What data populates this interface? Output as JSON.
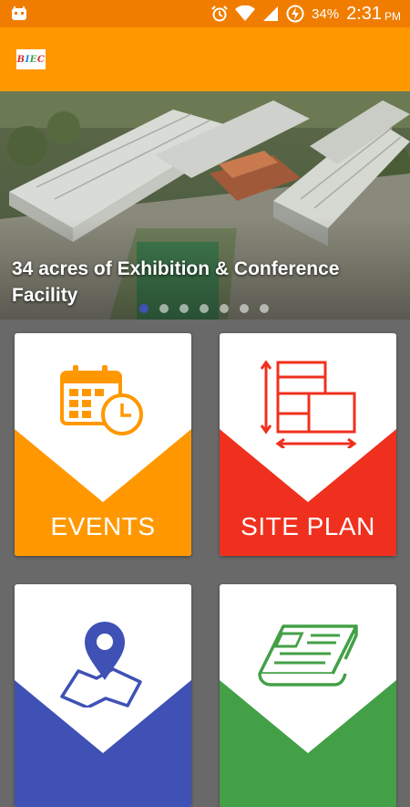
{
  "status_bar": {
    "battery": "34%",
    "time": "2:31",
    "ampm": "PM"
  },
  "app_bar": {
    "logo_text": [
      "B",
      "I",
      "E",
      "C"
    ]
  },
  "banner": {
    "caption": "34 acres of Exhibition & Conference Facility",
    "slide_count": 7,
    "active_slide": 0
  },
  "tiles": [
    {
      "label": "EVENTS",
      "color": "#ff9800",
      "icon": "calendar-clock-icon"
    },
    {
      "label": "SITE PLAN",
      "color": "#f0301e",
      "icon": "floor-plan-icon"
    },
    {
      "label": "",
      "color": "#3f51b5",
      "icon": "map-pin-icon"
    },
    {
      "label": "",
      "color": "#43a047",
      "icon": "newspaper-icon"
    }
  ]
}
